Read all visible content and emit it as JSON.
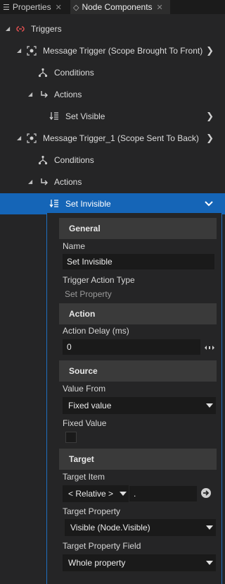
{
  "tabs": [
    {
      "label": "Properties",
      "icon": "properties-icon"
    },
    {
      "label": "Node Components",
      "icon": "node-components-icon"
    }
  ],
  "tree": {
    "triggers": "Triggers",
    "trigger1": "Message Trigger (Scope Brought To Front)",
    "conditions1": "Conditions",
    "actions1": "Actions",
    "action1": "Set Visible",
    "trigger2": "Message Trigger_1 (Scope Sent To Back)",
    "conditions2": "Conditions",
    "actions2": "Actions",
    "action2": "Set Invisible"
  },
  "properties": {
    "general": {
      "header": "General",
      "name_label": "Name",
      "name_value": "Set Invisible",
      "type_label": "Trigger Action Type",
      "type_value": "Set Property"
    },
    "action": {
      "header": "Action",
      "delay_label": "Action Delay (ms)",
      "delay_value": "0"
    },
    "source": {
      "header": "Source",
      "value_from_label": "Value From",
      "value_from_value": "Fixed value",
      "fixed_value_label": "Fixed Value",
      "fixed_value_checked": false
    },
    "target": {
      "header": "Target",
      "item_label": "Target Item",
      "item_relative": "< Relative >",
      "item_path": ".",
      "property_label": "Target Property",
      "property_value": "Visible (Node.Visible)",
      "field_label": "Target Property Field",
      "field_value": "Whole property"
    }
  },
  "colors": {
    "selection": "#1565b7",
    "panel_border": "#1e6fc0",
    "trigger_icon": "#e05050"
  }
}
